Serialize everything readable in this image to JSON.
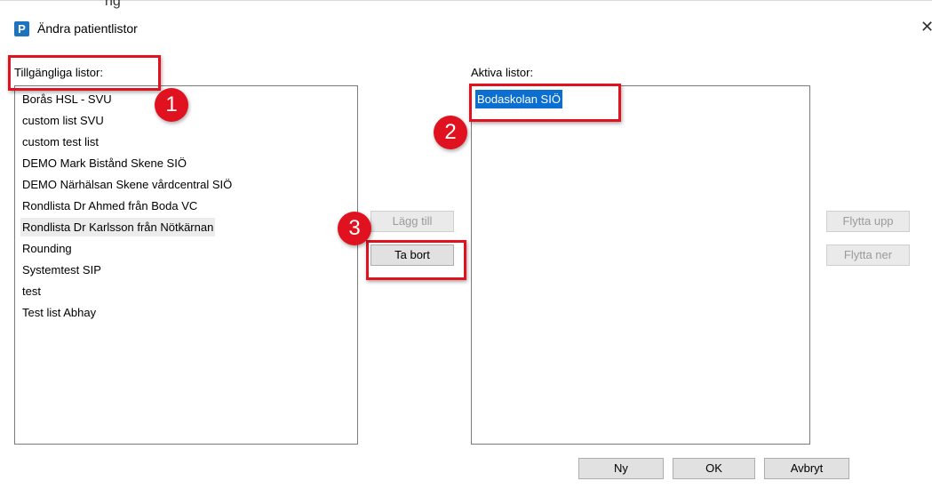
{
  "window": {
    "top_fragment": "ng",
    "app_icon_letter": "P",
    "title": "Ändra patientlistor",
    "close_symbol": "✕"
  },
  "available": {
    "label": "Tillgängliga listor:",
    "items": [
      "Borås HSL - SVU",
      "custom list SVU",
      "custom test list",
      "DEMO Mark Bistånd Skene SIÖ",
      "DEMO Närhälsan Skene vårdcentral SIÖ",
      "Rondlista Dr Ahmed från Boda VC",
      "Rondlista Dr Karlsson från Nötkärnan",
      "Rounding",
      "Systemtest SIP",
      "test",
      "Test list Abhay"
    ]
  },
  "active": {
    "label": "Aktiva listor:",
    "items": [
      "Bodaskolan SIÖ"
    ]
  },
  "buttons": {
    "add": "Lägg till",
    "remove": "Ta bort",
    "move_up": "Flytta upp",
    "move_down": "Flytta ner",
    "new": "Ny",
    "ok": "OK",
    "cancel": "Avbryt"
  },
  "annotations": [
    "1",
    "2",
    "3"
  ],
  "colors": {
    "annotation_red": "#e0121f",
    "selection_blue": "#0a6fd0",
    "app_icon_blue": "#1e73be"
  }
}
